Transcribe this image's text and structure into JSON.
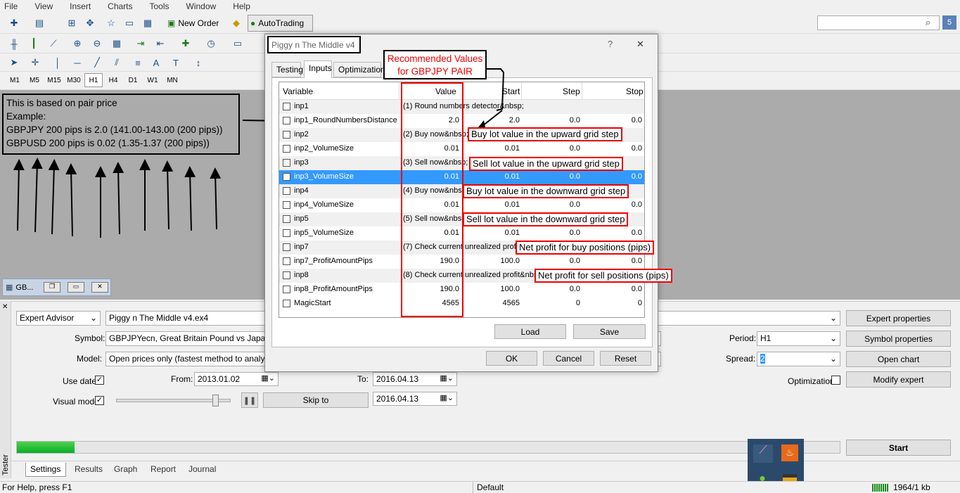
{
  "menu": [
    "File",
    "View",
    "Insert",
    "Charts",
    "Tools",
    "Window",
    "Help"
  ],
  "toolbar": {
    "new_order": "New Order",
    "autotrading": "AutoTrading"
  },
  "timeframes": [
    "M1",
    "M5",
    "M15",
    "M30",
    "H1",
    "H4",
    "D1",
    "W1",
    "MN"
  ],
  "note": {
    "line1": "This is based on pair price",
    "line2": "Example:",
    "line3": "GBPJPY 200 pips is 2.0 (141.00-143.00 (200 pips))",
    "line4": "GBPUSD 200 pips is 0.02 (1.35-1.37 (200 pips))"
  },
  "minimized": {
    "label": "GB..."
  },
  "dialog": {
    "title": "Piggy n The Middle v4",
    "help": "?",
    "close": "✕",
    "tabs": [
      "Testing",
      "Inputs",
      "Optimization"
    ],
    "headers": {
      "variable": "Variable",
      "value": "Value",
      "start": "Start",
      "step": "Step",
      "stop": "Stop"
    },
    "rows": [
      {
        "name": "inp1",
        "value": "(1) Round numbers detector&nbsp;",
        "start": "",
        "step": "",
        "stop": ""
      },
      {
        "name": "inp1_RoundNumbersDistance",
        "value": "2.0",
        "start": "2.0",
        "step": "0.0",
        "stop": "0.0"
      },
      {
        "name": "inp2",
        "value": "(2) Buy now&nbsp;",
        "start": "",
        "step": "",
        "stop": ""
      },
      {
        "name": "inp2_VolumeSize",
        "value": "0.01",
        "start": "0.01",
        "step": "0.0",
        "stop": "0.0"
      },
      {
        "name": "inp3",
        "value": "(3) Sell now&nbsp;",
        "start": "",
        "step": "",
        "stop": ""
      },
      {
        "name": "inp3_VolumeSize",
        "value": "0.01",
        "start": "0.01",
        "step": "0.0",
        "stop": "0.0"
      },
      {
        "name": "inp4",
        "value": "(4) Buy now&nbsp;",
        "start": "",
        "step": "",
        "stop": ""
      },
      {
        "name": "inp4_VolumeSize",
        "value": "0.01",
        "start": "0.01",
        "step": "0.0",
        "stop": "0.0"
      },
      {
        "name": "inp5",
        "value": "(5) Sell now&nbsp;",
        "start": "",
        "step": "",
        "stop": ""
      },
      {
        "name": "inp5_VolumeSize",
        "value": "0.01",
        "start": "0.01",
        "step": "0.0",
        "stop": "0.0"
      },
      {
        "name": "inp7",
        "value": "(7) Check current unrealized profit",
        "start": "",
        "step": "",
        "stop": ""
      },
      {
        "name": "inp7_ProfitAmountPips",
        "value": "190.0",
        "start": "100.0",
        "step": "0.0",
        "stop": "0.0"
      },
      {
        "name": "inp8",
        "value": "(8) Check current unrealized profit&nbsp;",
        "start": "",
        "step": "",
        "stop": ""
      },
      {
        "name": "inp8_ProfitAmountPips",
        "value": "190.0",
        "start": "100.0",
        "step": "0.0",
        "stop": "0.0"
      },
      {
        "name": "MagicStart",
        "value": "4565",
        "start": "4565",
        "step": "0",
        "stop": "0"
      }
    ],
    "load": "Load",
    "save": "Save",
    "ok": "OK",
    "cancel": "Cancel",
    "reset": "Reset"
  },
  "annotations": {
    "recommended": "Recommended Values for GBPJPY PAIR",
    "buy_up": "Buy lot value in the upward grid step",
    "sell_up": "Sell lot value in the upward grid step",
    "buy_down": "Buy lot value in the downward grid step",
    "sell_down": "Sell lot value in the downward grid step",
    "net_buy": "Net profit for buy positions (pips)",
    "net_sell": "Net profit for sell positions (pips)"
  },
  "tester": {
    "type": "Expert Advisor",
    "expert": "Piggy n The Middle v4.ex4",
    "symbol_label": "Symbol:",
    "symbol": "GBPJPYecn, Great Britain Pound vs Japanese",
    "model_label": "Model:",
    "model": "Open prices only (fastest method to analyze the",
    "use_date": "Use date",
    "from_label": "From:",
    "from": "2013.01.02",
    "to_label": "To:",
    "to": "2016.04.13",
    "visual_mode": "Visual mode",
    "skip_to": "Skip to",
    "skip_date": "2016.04.13",
    "period_label": "Period:",
    "period": "H1",
    "spread_label": "Spread:",
    "spread": "2",
    "optimization": "Optimization",
    "buttons": {
      "expert_properties": "Expert properties",
      "symbol_properties": "Symbol properties",
      "open_chart": "Open chart",
      "modify_expert": "Modify expert",
      "start": "Start"
    },
    "progress": 0.07,
    "side_label": "Tester",
    "tabs": [
      "Settings",
      "Results",
      "Graph",
      "Report",
      "Journal"
    ]
  },
  "status": {
    "help": "For Help, press F1",
    "profile": "Default",
    "traffic": "1964/1 kb"
  },
  "colors": {
    "accent": "#3399ff",
    "annotation": "#e00000",
    "workspace": "#ababab"
  }
}
